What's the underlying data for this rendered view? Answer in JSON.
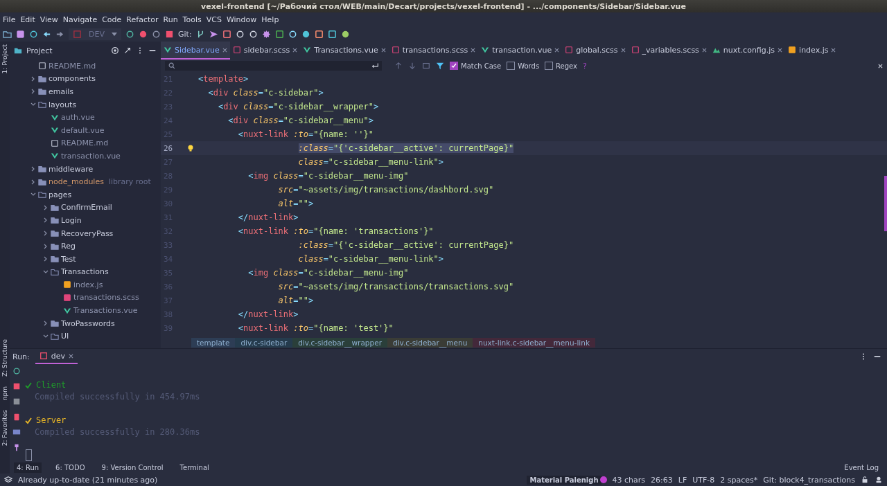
{
  "window": {
    "title": "vexel-frontend [~/Рабочий стол/WEB/main/Decart/projects/vexel-frontend] - .../components/Sidebar/Sidebar.vue"
  },
  "menu": [
    "File",
    "Edit",
    "View",
    "Navigate",
    "Code",
    "Refactor",
    "Run",
    "Tools",
    "VCS",
    "Window",
    "Help"
  ],
  "toolbar": {
    "run_config": "DEV",
    "git_label": "Git:"
  },
  "side_strip": {
    "top": "1: Project",
    "bottom": [
      "Z: Structure",
      "npm",
      "2: Favorites"
    ]
  },
  "project": {
    "title": "Project",
    "tree": [
      {
        "label": "README.md",
        "kind": "md"
      },
      {
        "label": "components",
        "kind": "folder",
        "expanded": false
      },
      {
        "label": "emails",
        "kind": "folder",
        "expanded": false
      },
      {
        "label": "layouts",
        "kind": "folder",
        "expanded": true,
        "children": [
          {
            "label": "auth.vue",
            "kind": "vue"
          },
          {
            "label": "default.vue",
            "kind": "vue"
          },
          {
            "label": "README.md",
            "kind": "md"
          },
          {
            "label": "transaction.vue",
            "kind": "vue"
          }
        ]
      },
      {
        "label": "middleware",
        "kind": "folder",
        "expanded": false
      },
      {
        "label": "node_modules",
        "kind": "folder",
        "expanded": false,
        "note": "library root"
      },
      {
        "label": "pages",
        "kind": "folder",
        "expanded": true,
        "children": [
          {
            "label": "ConfirmEmail",
            "kind": "folder",
            "expanded": false
          },
          {
            "label": "Login",
            "kind": "folder",
            "expanded": false
          },
          {
            "label": "RecoveryPass",
            "kind": "folder",
            "expanded": false
          },
          {
            "label": "Reg",
            "kind": "folder",
            "expanded": false
          },
          {
            "label": "Test",
            "kind": "folder",
            "expanded": false
          },
          {
            "label": "Transactions",
            "kind": "folder",
            "expanded": true,
            "children": [
              {
                "label": "index.js",
                "kind": "js"
              },
              {
                "label": "transactions.scss",
                "kind": "scss"
              },
              {
                "label": "Transactions.vue",
                "kind": "vue"
              }
            ]
          },
          {
            "label": "TwoPasswords",
            "kind": "folder",
            "expanded": false
          },
          {
            "label": "UI",
            "kind": "folder",
            "expanded": true
          }
        ]
      }
    ]
  },
  "tabs": [
    {
      "label": "Sidebar.vue",
      "kind": "vue",
      "selected": true
    },
    {
      "label": "sidebar.scss",
      "kind": "scss",
      "selected": false
    },
    {
      "label": "Transactions.vue",
      "kind": "vue",
      "selected": false
    },
    {
      "label": "transactions.scss",
      "kind": "scss",
      "selected": false
    },
    {
      "label": "transaction.vue",
      "kind": "vue",
      "selected": false
    },
    {
      "label": "global.scss",
      "kind": "scss",
      "selected": false
    },
    {
      "label": "_variables.scss",
      "kind": "scss",
      "selected": false
    },
    {
      "label": "nuxt.config.js",
      "kind": "nuxt",
      "selected": false
    },
    {
      "label": "index.js",
      "kind": "js",
      "selected": false
    }
  ],
  "find": {
    "options": [
      {
        "label": "Match Case",
        "checked": true
      },
      {
        "label": "Words",
        "checked": false
      },
      {
        "label": "Regex",
        "checked": false
      }
    ],
    "help": "?"
  },
  "code": [
    {
      "number": "21",
      "selected": false,
      "tokens": [
        {
          "kind": "punct",
          "text": "<"
        },
        {
          "kind": "tag",
          "text": "template"
        },
        {
          "kind": "punct",
          "text": ">"
        }
      ]
    },
    {
      "number": "22",
      "selected": false,
      "tokens": [
        {
          "kind": "punct",
          "text": "  <"
        },
        {
          "kind": "tag",
          "text": "div "
        },
        {
          "kind": "attr",
          "text": "class"
        },
        {
          "kind": "punct",
          "text": "="
        },
        {
          "kind": "str",
          "text": "\"c-sidebar\""
        },
        {
          "kind": "punct",
          "text": ">"
        }
      ]
    },
    {
      "number": "23",
      "selected": false,
      "tokens": [
        {
          "kind": "punct",
          "text": "    <"
        },
        {
          "kind": "tag",
          "text": "div "
        },
        {
          "kind": "attr",
          "text": "class"
        },
        {
          "kind": "punct",
          "text": "="
        },
        {
          "kind": "str",
          "text": "\"c-sidebar__wrapper\""
        },
        {
          "kind": "punct",
          "text": ">"
        }
      ]
    },
    {
      "number": "24",
      "selected": false,
      "tokens": [
        {
          "kind": "punct",
          "text": "      <"
        },
        {
          "kind": "tag",
          "text": "div "
        },
        {
          "kind": "attr",
          "text": "class"
        },
        {
          "kind": "punct",
          "text": "="
        },
        {
          "kind": "str",
          "text": "\"c-sidebar__menu\""
        },
        {
          "kind": "punct",
          "text": ">"
        }
      ]
    },
    {
      "number": "25",
      "selected": false,
      "tokens": [
        {
          "kind": "punct",
          "text": "        <"
        },
        {
          "kind": "tag",
          "text": "nuxt-link "
        },
        {
          "kind": "attr",
          "text": ":to"
        },
        {
          "kind": "punct",
          "text": "="
        },
        {
          "kind": "str",
          "text": "\"{name: ''}\""
        }
      ]
    },
    {
      "number": "26",
      "selected": true,
      "tokens": [
        {
          "kind": "attr",
          "text": "                    :class"
        },
        {
          "kind": "punct",
          "text": "="
        },
        {
          "kind": "str",
          "text": "\"{'c-sidebar__active': currentPage}\""
        }
      ]
    },
    {
      "number": "27",
      "selected": false,
      "tokens": [
        {
          "kind": "attr",
          "text": "                    class"
        },
        {
          "kind": "punct",
          "text": "="
        },
        {
          "kind": "str",
          "text": "\"c-sidebar__menu-link\""
        },
        {
          "kind": "punct",
          "text": ">"
        }
      ]
    },
    {
      "number": "28",
      "selected": false,
      "tokens": [
        {
          "kind": "punct",
          "text": "          <"
        },
        {
          "kind": "tag",
          "text": "img "
        },
        {
          "kind": "attr",
          "text": "class"
        },
        {
          "kind": "punct",
          "text": "="
        },
        {
          "kind": "str",
          "text": "\"c-sidebar__menu-img\""
        }
      ]
    },
    {
      "number": "29",
      "selected": false,
      "tokens": [
        {
          "kind": "attr",
          "text": "                src"
        },
        {
          "kind": "punct",
          "text": "="
        },
        {
          "kind": "str",
          "text": "\"~assets/img/transactions/dashbord.svg\""
        }
      ]
    },
    {
      "number": "30",
      "selected": false,
      "tokens": [
        {
          "kind": "attr",
          "text": "                alt"
        },
        {
          "kind": "punct",
          "text": "="
        },
        {
          "kind": "str",
          "text": "\"\""
        },
        {
          "kind": "punct",
          "text": ">"
        }
      ]
    },
    {
      "number": "31",
      "selected": false,
      "tokens": [
        {
          "kind": "punct",
          "text": "        </"
        },
        {
          "kind": "tag",
          "text": "nuxt-link"
        },
        {
          "kind": "punct",
          "text": ">"
        }
      ]
    },
    {
      "number": "32",
      "selected": false,
      "tokens": [
        {
          "kind": "punct",
          "text": "        <"
        },
        {
          "kind": "tag",
          "text": "nuxt-link "
        },
        {
          "kind": "attr",
          "text": ":to"
        },
        {
          "kind": "punct",
          "text": "="
        },
        {
          "kind": "str",
          "text": "\"{name: 'transactions'}\""
        }
      ]
    },
    {
      "number": "33",
      "selected": false,
      "tokens": [
        {
          "kind": "attr",
          "text": "                    :class"
        },
        {
          "kind": "punct",
          "text": "="
        },
        {
          "kind": "str",
          "text": "\"{'c-sidebar__active': currentPage}\""
        }
      ]
    },
    {
      "number": "34",
      "selected": false,
      "tokens": [
        {
          "kind": "attr",
          "text": "                    class"
        },
        {
          "kind": "punct",
          "text": "="
        },
        {
          "kind": "str",
          "text": "\"c-sidebar__menu-link\""
        },
        {
          "kind": "punct",
          "text": ">"
        }
      ]
    },
    {
      "number": "35",
      "selected": false,
      "tokens": [
        {
          "kind": "punct",
          "text": "          <"
        },
        {
          "kind": "tag",
          "text": "img "
        },
        {
          "kind": "attr",
          "text": "class"
        },
        {
          "kind": "punct",
          "text": "="
        },
        {
          "kind": "str",
          "text": "\"c-sidebar__menu-img\""
        }
      ]
    },
    {
      "number": "36",
      "selected": false,
      "tokens": [
        {
          "kind": "attr",
          "text": "                src"
        },
        {
          "kind": "punct",
          "text": "="
        },
        {
          "kind": "str",
          "text": "\"~assets/img/transactions/transactions.svg\""
        }
      ]
    },
    {
      "number": "37",
      "selected": false,
      "tokens": [
        {
          "kind": "attr",
          "text": "                alt"
        },
        {
          "kind": "punct",
          "text": "="
        },
        {
          "kind": "str",
          "text": "\"\""
        },
        {
          "kind": "punct",
          "text": ">"
        }
      ]
    },
    {
      "number": "38",
      "selected": false,
      "tokens": [
        {
          "kind": "punct",
          "text": "        </"
        },
        {
          "kind": "tag",
          "text": "nuxt-link"
        },
        {
          "kind": "punct",
          "text": ">"
        }
      ]
    },
    {
      "number": "39",
      "selected": false,
      "tokens": [
        {
          "kind": "punct",
          "text": "        <"
        },
        {
          "kind": "tag",
          "text": "nuxt-link "
        },
        {
          "kind": "attr",
          "text": ":to"
        },
        {
          "kind": "punct",
          "text": "="
        },
        {
          "kind": "str",
          "text": "\"{name: 'test'}\""
        }
      ]
    }
  ],
  "breadcrumbs": [
    {
      "label": "template",
      "color": "#2d3d55"
    },
    {
      "label": "div.c-sidebar",
      "color": "#253b4d"
    },
    {
      "label": "div.c-sidebar__wrapper",
      "color": "#2a3f3a"
    },
    {
      "label": "div.c-sidebar__menu",
      "color": "#3a3c36"
    },
    {
      "label": "nuxt-link.c-sidebar__menu-link",
      "color": "#43283a"
    }
  ],
  "run": {
    "label": "Run:",
    "tab": "dev",
    "output": [
      {
        "kind": "ok",
        "text": "Client",
        "color": "#1f9c2a"
      },
      {
        "kind": "message",
        "text": "Compiled successfully in 454.97ms"
      },
      {
        "kind": "blank"
      },
      {
        "kind": "ok",
        "text": "Server",
        "color": "#e8b627"
      },
      {
        "kind": "message",
        "text": "Compiled successfully in 280.36ms"
      }
    ]
  },
  "tool_tabs": [
    {
      "label": "4: Run",
      "selected": true
    },
    {
      "label": "6: TODO",
      "selected": false
    },
    {
      "label": "9: Version Control",
      "selected": false
    },
    {
      "label": "Terminal",
      "selected": false
    }
  ],
  "event_log": "Event Log",
  "status_bar": {
    "message": "Already up-to-date (21 minutes ago)",
    "theme": "Material Palenigh",
    "items": [
      "43 chars",
      "26:63",
      "LF",
      "UTF-8",
      "2 spaces*",
      "Git: block4_transactions"
    ]
  }
}
